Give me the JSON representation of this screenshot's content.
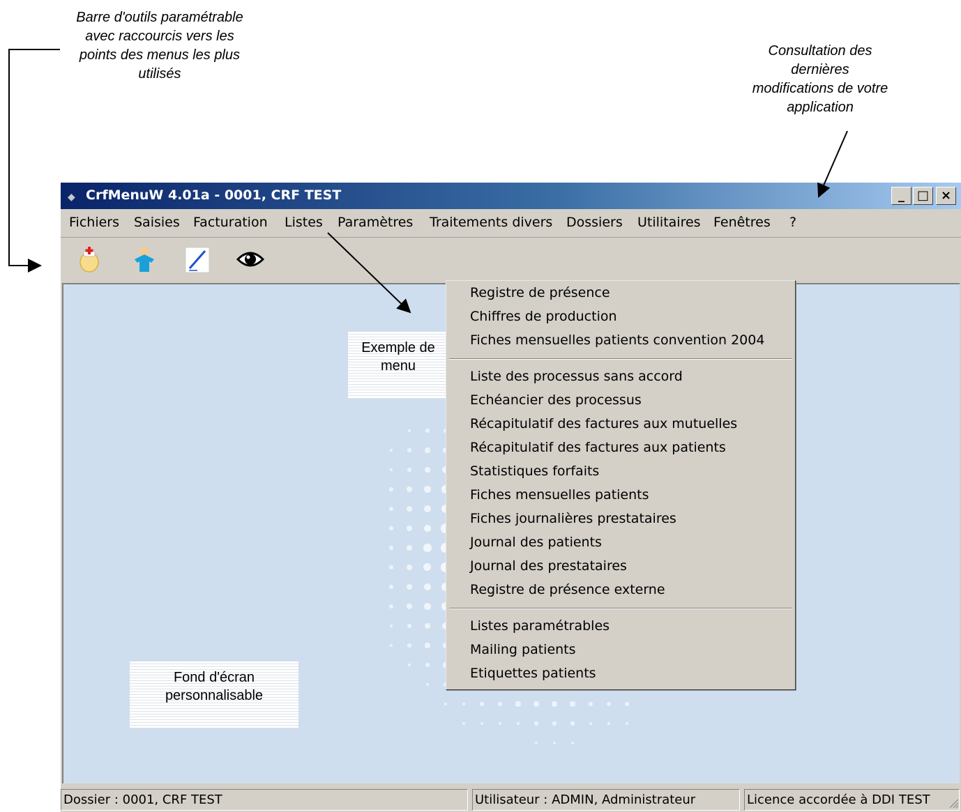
{
  "annotations": {
    "toolbar_note": "Barre d'outils paramétrable avec raccourcis vers les points des menus les plus utilisés",
    "modifications_note": "Consultation des dernières modifications de votre application",
    "menu_example": "Exemple de menu",
    "background_note": "Fond d'écran personnalisable"
  },
  "window": {
    "title": "CrfMenuW 4.01a - 0001, CRF TEST",
    "buttons": {
      "minimize": "_",
      "maximize": "□",
      "close": "×"
    }
  },
  "menubar": [
    "Fichiers",
    "Saisies",
    "Facturation",
    "Listes",
    "Paramètres",
    "Traitements divers",
    "Dossiers",
    "Utilitaires",
    "Fenêtres",
    "?"
  ],
  "toolbar": {
    "icons": [
      "nurse-icon",
      "shirt-icon",
      "pen-icon",
      "eye-icon"
    ]
  },
  "dropdown": {
    "groups": [
      [
        "Registre de présence",
        "Chiffres de production",
        "Fiches mensuelles patients convention 2004"
      ],
      [
        "Liste des processus sans accord",
        "Echéancier des processus",
        "Récapitulatif des factures aux mutuelles",
        "Récapitulatif des factures aux patients",
        "Statistiques forfaits",
        "Fiches mensuelles patients",
        "Fiches journalières prestataires",
        "Journal des patients",
        "Journal des prestataires",
        "Registre de présence externe"
      ],
      [
        "Listes paramétrables",
        "Mailing patients",
        "Etiquettes patients"
      ]
    ]
  },
  "statusbar": {
    "dossier": "Dossier : 0001, CRF TEST",
    "user": "Utilisateur : ADMIN, Administrateur",
    "licence": "Licence accordée à DDI TEST"
  }
}
